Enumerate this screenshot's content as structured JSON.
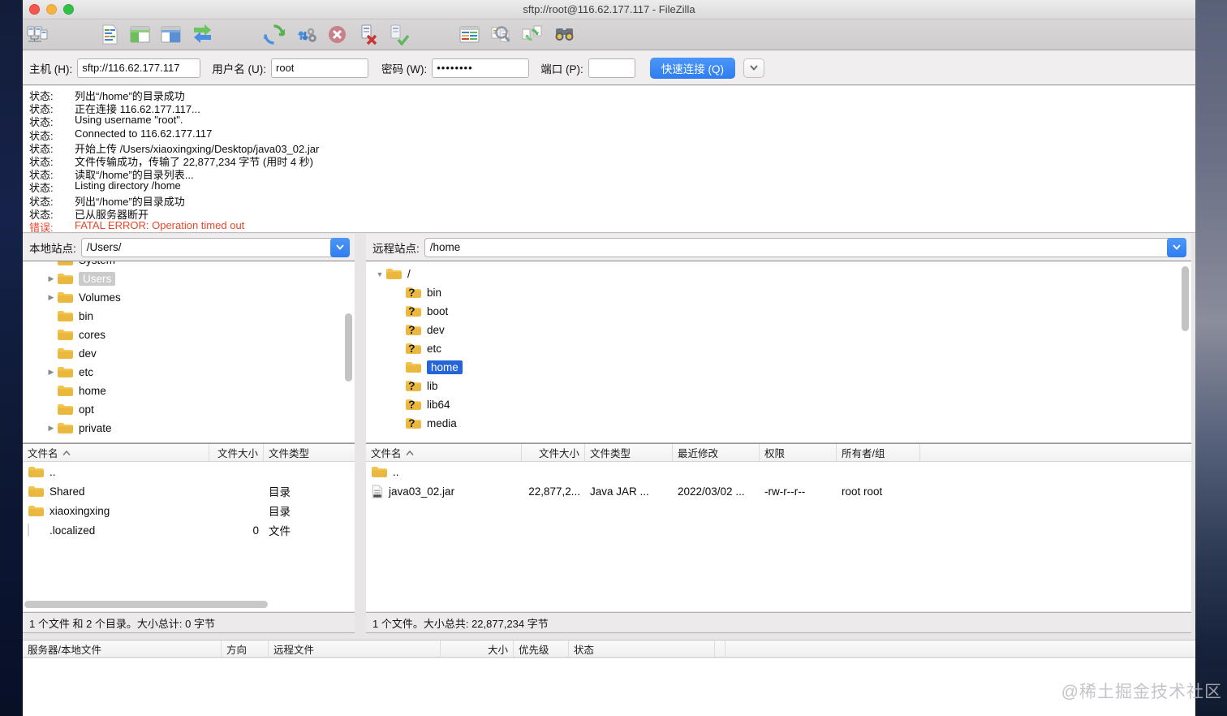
{
  "window": {
    "title": "sftp://root@116.62.177.117 - FileZilla"
  },
  "toolbar": {
    "icons": [
      "site-manager",
      "message-log-toggle",
      "local-tree-toggle",
      "remote-tree-toggle",
      "transfer-queue-toggle",
      "refresh",
      "process-queue",
      "cancel-operation",
      "disconnect",
      "reconnect",
      "directory-comparison",
      "filename-filters",
      "synchronized-browsing",
      "file-search"
    ]
  },
  "quickconnect": {
    "host_label": "主机 (H):",
    "host_value": "sftp://116.62.177.117",
    "user_label": "用户名 (U):",
    "user_value": "root",
    "password_label": "密码 (W):",
    "password_value": "••••••••",
    "port_label": "端口 (P):",
    "port_value": "",
    "connect_label": "快速连接 (Q)",
    "dropdown_icon": "▼"
  },
  "log": {
    "entries": [
      {
        "label": "状态:",
        "text": "列出“/home”的目录成功"
      },
      {
        "label": "状态:",
        "text": "正在连接 116.62.177.117..."
      },
      {
        "label": "状态:",
        "text": "Using username \"root\"."
      },
      {
        "label": "状态:",
        "text": "Connected to 116.62.177.117"
      },
      {
        "label": "状态:",
        "text": "开始上传 /Users/xiaoxingxing/Desktop/java03_02.jar"
      },
      {
        "label": "状态:",
        "text": "文件传输成功，传输了 22,877,234 字节 (用时 4 秒)"
      },
      {
        "label": "状态:",
        "text": "读取“/home”的目录列表..."
      },
      {
        "label": "状态:",
        "text": "Listing directory /home"
      },
      {
        "label": "状态:",
        "text": "列出“/home”的目录成功"
      },
      {
        "label": "状态:",
        "text": "已从服务器断开"
      },
      {
        "label": "错误:",
        "text": "FATAL ERROR: Operation timed out"
      }
    ]
  },
  "local_pane": {
    "site_label": "本地站点:",
    "path": "/Users/",
    "tree": [
      {
        "arrow": "",
        "name": "System"
      },
      {
        "arrow": "▶",
        "name": "Users"
      },
      {
        "arrow": "▶",
        "name": "Volumes"
      },
      {
        "arrow": "",
        "name": "bin"
      },
      {
        "arrow": "",
        "name": "cores"
      },
      {
        "arrow": "",
        "name": "dev"
      },
      {
        "arrow": "▶",
        "name": "etc"
      },
      {
        "arrow": "",
        "name": "home"
      },
      {
        "arrow": "",
        "name": "opt"
      },
      {
        "arrow": "▶",
        "name": "private"
      }
    ],
    "columns": [
      "文件名",
      "文件大小",
      "文件类型"
    ],
    "rows": [
      {
        "name": "..",
        "size": "",
        "type": ""
      },
      {
        "name": "Shared",
        "size": "",
        "type": "目录"
      },
      {
        "name": "xiaoxingxing",
        "size": "",
        "type": "目录"
      },
      {
        "name": ".localized",
        "size": "0",
        "type": "文件"
      }
    ],
    "status": "1 个文件 和 2 个目录。大小总计: 0 字节"
  },
  "remote_pane": {
    "site_label": "远程站点:",
    "path": "/home",
    "tree": [
      {
        "arrow": "▼",
        "name": "/"
      },
      {
        "arrow": "",
        "name": "bin"
      },
      {
        "arrow": "",
        "name": "boot"
      },
      {
        "arrow": "",
        "name": "dev"
      },
      {
        "arrow": "",
        "name": "etc"
      },
      {
        "arrow": "",
        "name": "home"
      },
      {
        "arrow": "",
        "name": "lib"
      },
      {
        "arrow": "",
        "name": "lib64"
      },
      {
        "arrow": "",
        "name": "media"
      }
    ],
    "columns": [
      "文件名",
      "文件大小",
      "文件类型",
      "最近修改",
      "权限",
      "所有者/组"
    ],
    "rows": [
      {
        "name": "..",
        "size": "",
        "type": "",
        "modified": "",
        "perms": "",
        "owner": ""
      },
      {
        "name": "java03_02.jar",
        "size": "22,877,2...",
        "type": "Java JAR ...",
        "modified": "2022/03/02  ...",
        "perms": "-rw-r--r--",
        "owner": "root root"
      }
    ],
    "status": "1 个文件。大小总共: 22,877,234 字节"
  },
  "queue": {
    "columns": [
      "服务器/本地文件",
      "方向",
      "远程文件",
      "大小",
      "优先级",
      "状态"
    ]
  },
  "watermark": "@稀土掘金技术社区"
}
